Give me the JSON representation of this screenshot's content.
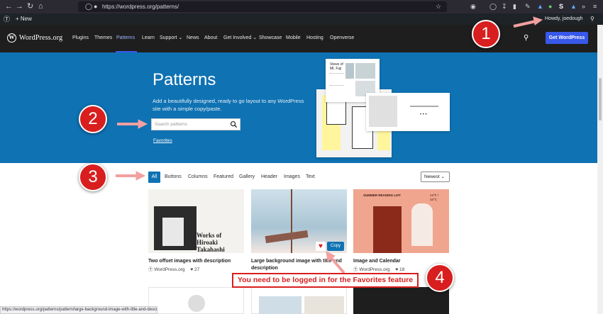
{
  "browser": {
    "url": "https://wordpress.org/patterns/",
    "status_url": "https://wordpress.org/patterns/pattern/large-background-image-with-title-and-description/"
  },
  "admin_bar": {
    "new_label": "New",
    "howdy": "Howdy, joedough"
  },
  "nav": {
    "logo_letter": "W",
    "logo_text": "WordPress.org",
    "items": [
      "Plugins",
      "Themes",
      "Patterns",
      "Learn",
      "Support",
      "News",
      "About",
      "Get Involved",
      "Showcase",
      "Mobile",
      "Hosting",
      "Openverse"
    ],
    "cta": "Get WordPress"
  },
  "hero": {
    "title": "Patterns",
    "desc_line1": "Add a beautifully designed, ready to go layout to any WordPress",
    "desc_line2": "site with a simple copy/paste.",
    "search_placeholder": "Search patterns",
    "favorites": "Favorites",
    "card1_title": "Views of Mt. Fuji"
  },
  "filters": {
    "categories": [
      "All",
      "Buttons",
      "Columns",
      "Featured",
      "Gallery",
      "Header",
      "Images",
      "Text"
    ],
    "sort": "Newest"
  },
  "patterns": [
    {
      "title": "Two offset images with description",
      "author": "WordPress.org",
      "likes": "27",
      "thumb_text": "Works of Hiroaki Takahashi"
    },
    {
      "title_line1": "Large background image with title and",
      "title_line2": "description",
      "copy_label": "Copy"
    },
    {
      "title": "Image and Calendar",
      "author": "WordPress.org",
      "likes": "18",
      "thumb_text": "SUMMER READING LIST",
      "thumb_temp": "13°F / 43°C"
    }
  ],
  "annotations": {
    "badges": [
      "1",
      "2",
      "3",
      "4"
    ],
    "callout": "You need to be logged in for the Favorites feature"
  },
  "colors": {
    "hero_blue": "#0f72b3",
    "nav_dark": "#1e1e1e",
    "accent": "#3858e9",
    "annotation_red": "#d81e1e",
    "arrow_pink": "#f2a0a0"
  }
}
